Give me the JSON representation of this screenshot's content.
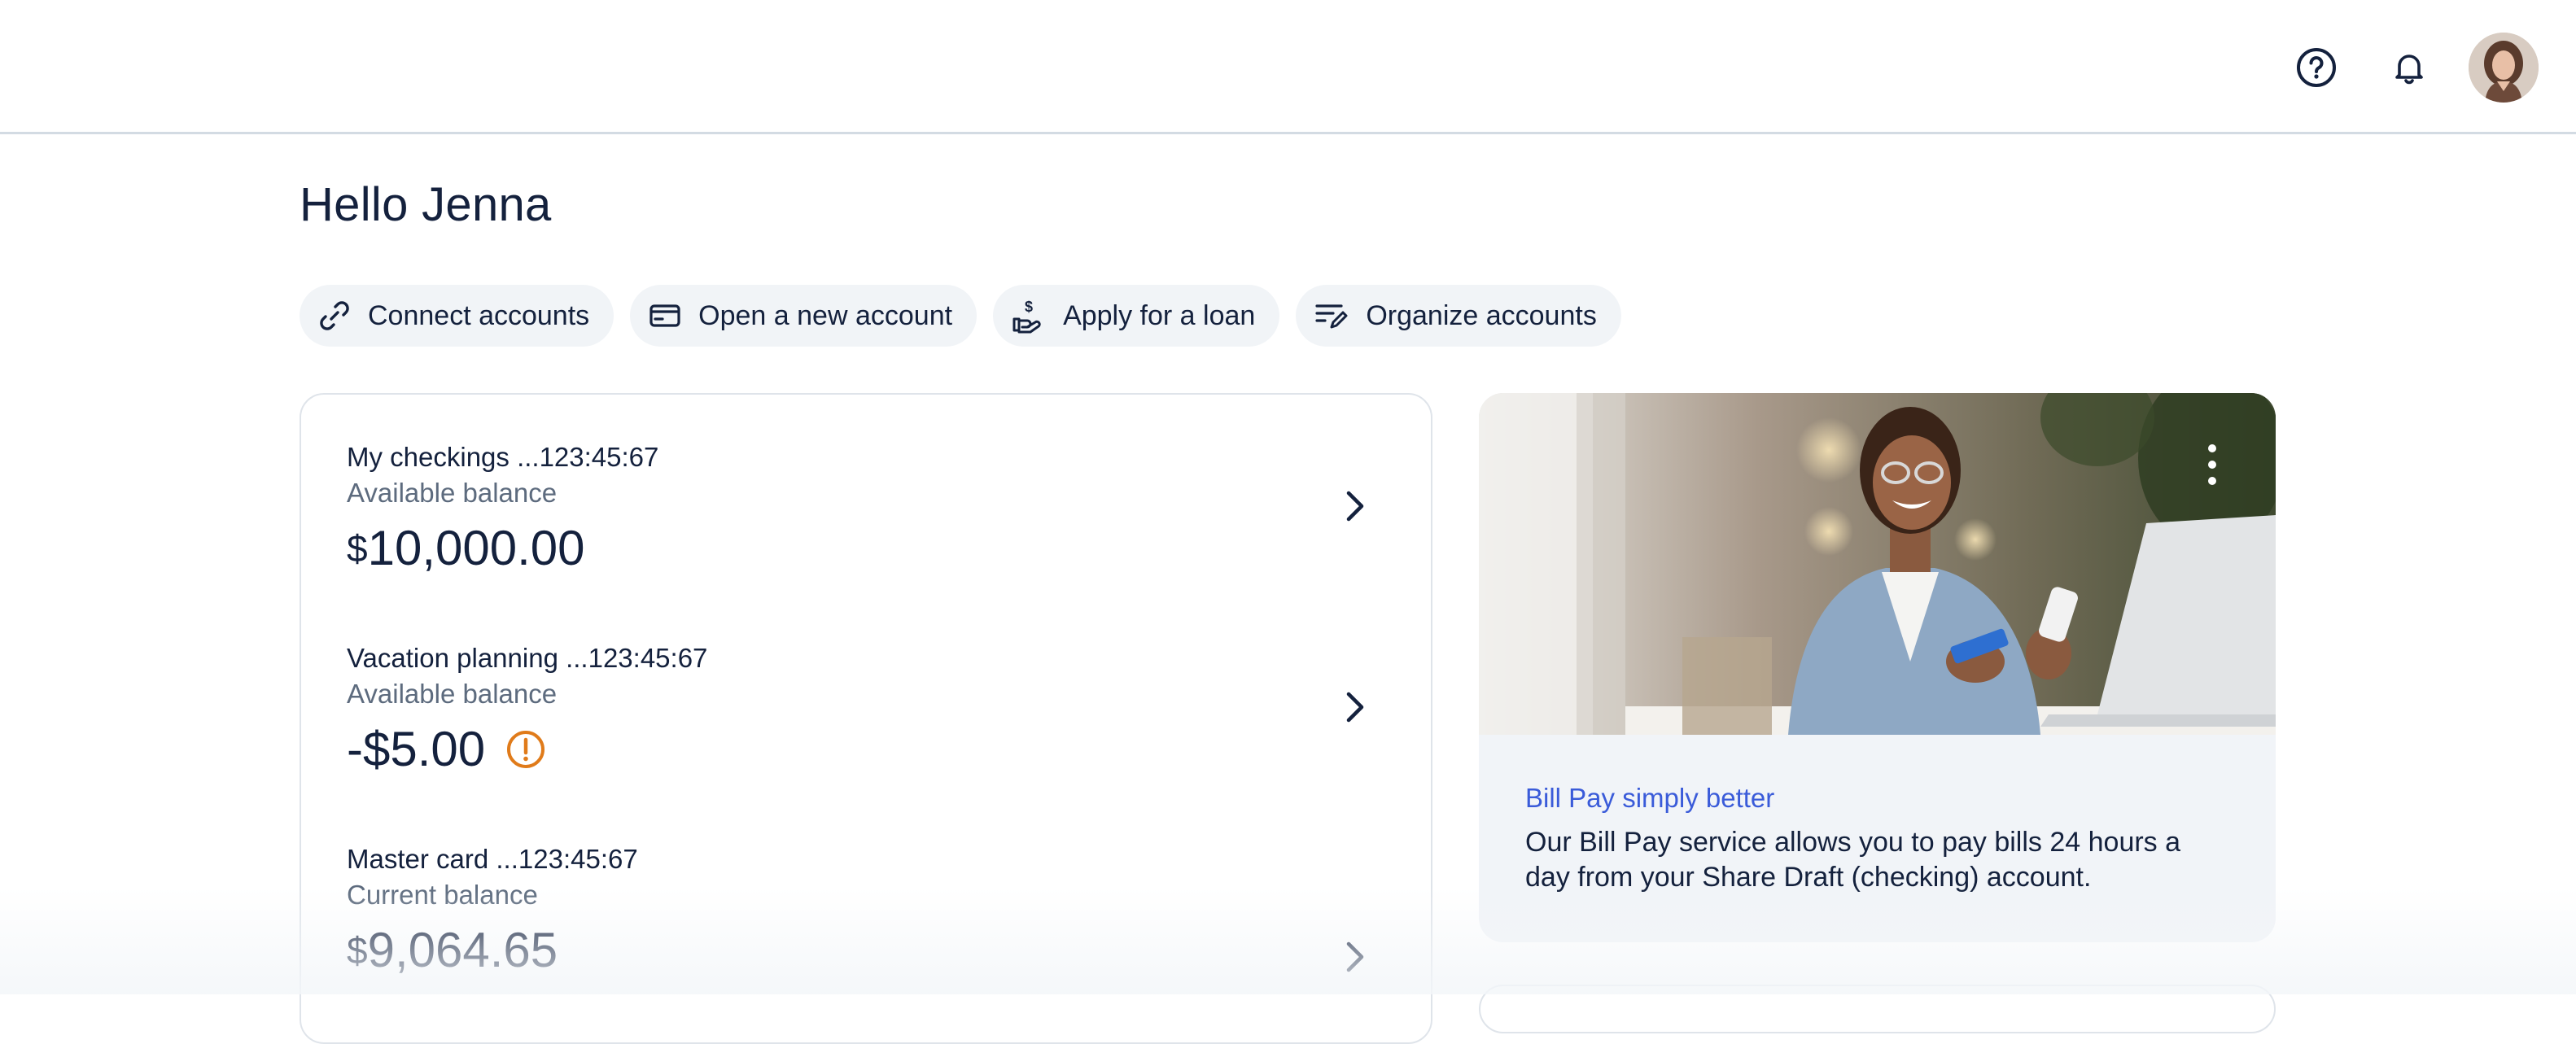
{
  "header": {
    "help_icon": "help-circle-icon",
    "notifications_icon": "bell-icon",
    "avatar_alt": "user-avatar"
  },
  "greeting": "Hello Jenna",
  "actions": [
    {
      "label": "Connect accounts",
      "icon": "link-icon"
    },
    {
      "label": "Open a new account",
      "icon": "card-icon"
    },
    {
      "label": "Apply for a loan",
      "icon": "loan-hand-icon"
    },
    {
      "label": "Organize accounts",
      "icon": "organize-icon"
    }
  ],
  "accounts": [
    {
      "name": "My checkings ...123:45:67",
      "balance_label": "Available balance",
      "currency": "$",
      "amount": "10,000.00",
      "sign": ""
    },
    {
      "name": "Vacation planning ...123:45:67",
      "balance_label": "Available balance",
      "currency": "$",
      "amount": "5.00",
      "sign": "-",
      "warning": true
    },
    {
      "name": "Master card ...123:45:67",
      "balance_label": "Current balance",
      "currency": "$",
      "amount": "9,064.65",
      "sign": ""
    }
  ],
  "promo": {
    "title": "Bill Pay simply better",
    "text": "Our Bill Pay service allows you to pay bills 24 hours a day from your Share Draft (checking) account."
  },
  "colors": {
    "primary_text": "#14213d",
    "secondary_text": "#5d6b7e",
    "link": "#3a5bd9",
    "warning": "#e07b1a",
    "chip_bg": "#f1f4f7",
    "card_border": "#dfe4ea"
  }
}
